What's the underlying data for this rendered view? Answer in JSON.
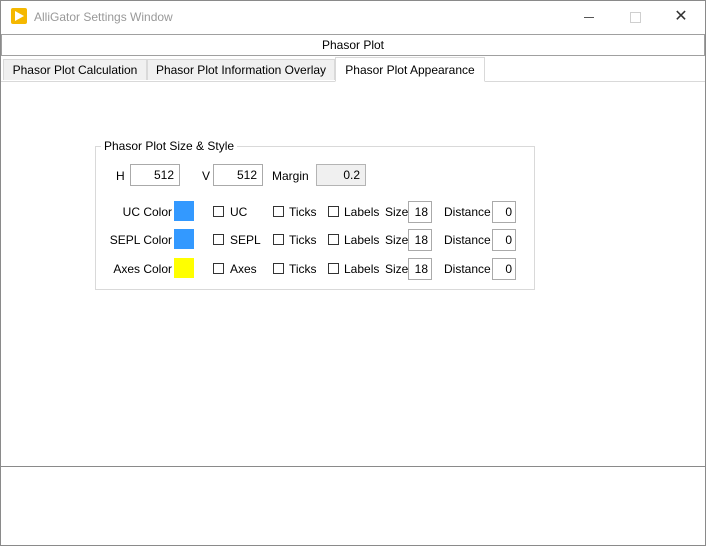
{
  "window": {
    "title": "AlliGator Settings Window",
    "min_icon": "minimize-icon",
    "max_icon": "maximize-icon",
    "close_icon": "close-icon",
    "close_glyph": "✕"
  },
  "section_header": "Phasor Plot",
  "tabs": [
    {
      "label": "Phasor Plot Calculation",
      "active": false
    },
    {
      "label": "Phasor Plot Information Overlay",
      "active": false
    },
    {
      "label": "Phasor Plot Appearance",
      "active": true
    }
  ],
  "group": {
    "title": "Phasor Plot Size & Style",
    "h_label": "H",
    "h_value": "512",
    "v_label": "V",
    "v_value": "512",
    "margin_label": "Margin",
    "margin_value": "0.2",
    "rows": [
      {
        "color_label": "UC Color",
        "color": "#3399ff",
        "show_label": "UC",
        "show_checked": false,
        "ticks_label": "Ticks",
        "ticks_checked": false,
        "labels_label": "Labels",
        "labels_checked": false,
        "size_label": "Size",
        "size_value": "18",
        "distance_label": "Distance",
        "distance_value": "0"
      },
      {
        "color_label": "SEPL Color",
        "color": "#3399ff",
        "show_label": "SEPL",
        "show_checked": false,
        "ticks_label": "Ticks",
        "ticks_checked": false,
        "labels_label": "Labels",
        "labels_checked": false,
        "size_label": "Size",
        "size_value": "18",
        "distance_label": "Distance",
        "distance_value": "0"
      },
      {
        "color_label": "Axes Color",
        "color": "#ffff00",
        "show_label": "Axes",
        "show_checked": false,
        "ticks_label": "Ticks",
        "ticks_checked": false,
        "labels_label": "Labels",
        "labels_checked": false,
        "size_label": "Size",
        "size_value": "18",
        "distance_label": "Distance",
        "distance_value": "0"
      }
    ]
  },
  "colors": {
    "accent_icon": "#f5b800",
    "tab_inactive": "#f0f0f0"
  }
}
